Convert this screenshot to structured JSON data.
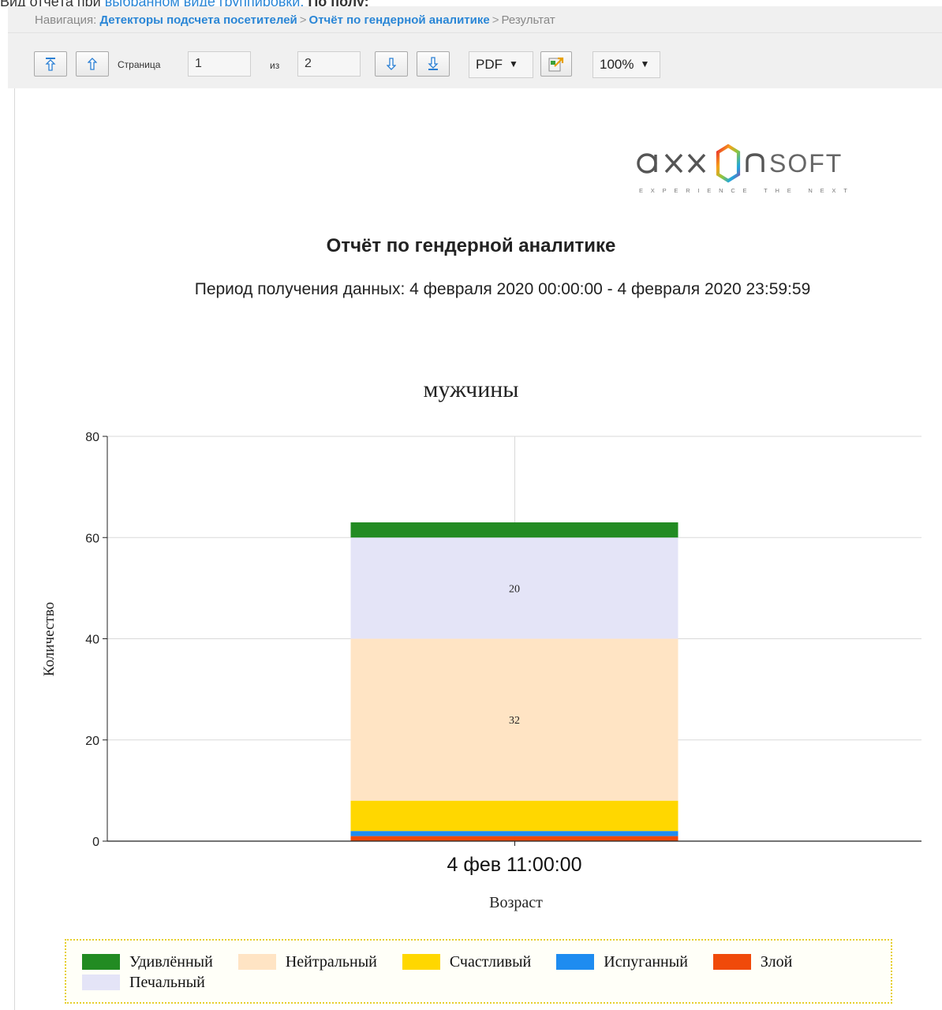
{
  "caption": {
    "prefix": "Вид отчёта при ",
    "link": "выбранном виде группировки: ",
    "bold": "По полу:"
  },
  "nav": {
    "label": "Навигация: ",
    "crumbs": [
      "Детекторы подсчета посетителей",
      "Отчёт по гендерной аналитике",
      "Результат"
    ],
    "separator": ">"
  },
  "toolbar": {
    "first_page": "first-page-icon",
    "prev_page": "prev-page-icon",
    "page_label": "Страница",
    "page_value": "1",
    "of_label": "из",
    "total_pages": "2",
    "next_page": "next-page-icon",
    "last_page": "last-page-icon",
    "format": "PDF",
    "export": "export-icon",
    "zoom": "100%"
  },
  "report": {
    "logo_text": "axxonsoft",
    "logo_tagline": "EXPERIENCE THE NEXT",
    "title": "Отчёт по гендерной аналитике",
    "period": "Период получения данных: 4 февраля 2020 00:00:00 - 4 февраля 2020 23:59:59"
  },
  "chart_data": {
    "type": "bar",
    "stacked": true,
    "title": "мужчины",
    "xlabel": "Возраст",
    "ylabel": "Количество",
    "categories": [
      "4 фев 11:00:00"
    ],
    "ylim": [
      0,
      80
    ],
    "yticks": [
      0,
      20,
      40,
      60,
      80
    ],
    "grid": true,
    "legend_position": "bottom",
    "series": [
      {
        "name": "Злой",
        "values": [
          1
        ],
        "color": "#f04a0a"
      },
      {
        "name": "Испуганный",
        "values": [
          1
        ],
        "color": "#1e8cf0"
      },
      {
        "name": "Счастливый",
        "values": [
          6
        ],
        "color": "#ffd700"
      },
      {
        "name": "Нейтральный",
        "values": [
          32
        ],
        "color": "#ffe4c4",
        "label": "32"
      },
      {
        "name": "Печальный",
        "values": [
          20
        ],
        "color": "#e4e4f7",
        "label": "20"
      },
      {
        "name": "Удивлённый",
        "values": [
          3
        ],
        "color": "#228b22"
      }
    ],
    "legend_order": [
      "Удивлённый",
      "Нейтральный",
      "Счастливый",
      "Испуганный",
      "Злой",
      "Печальный"
    ]
  }
}
